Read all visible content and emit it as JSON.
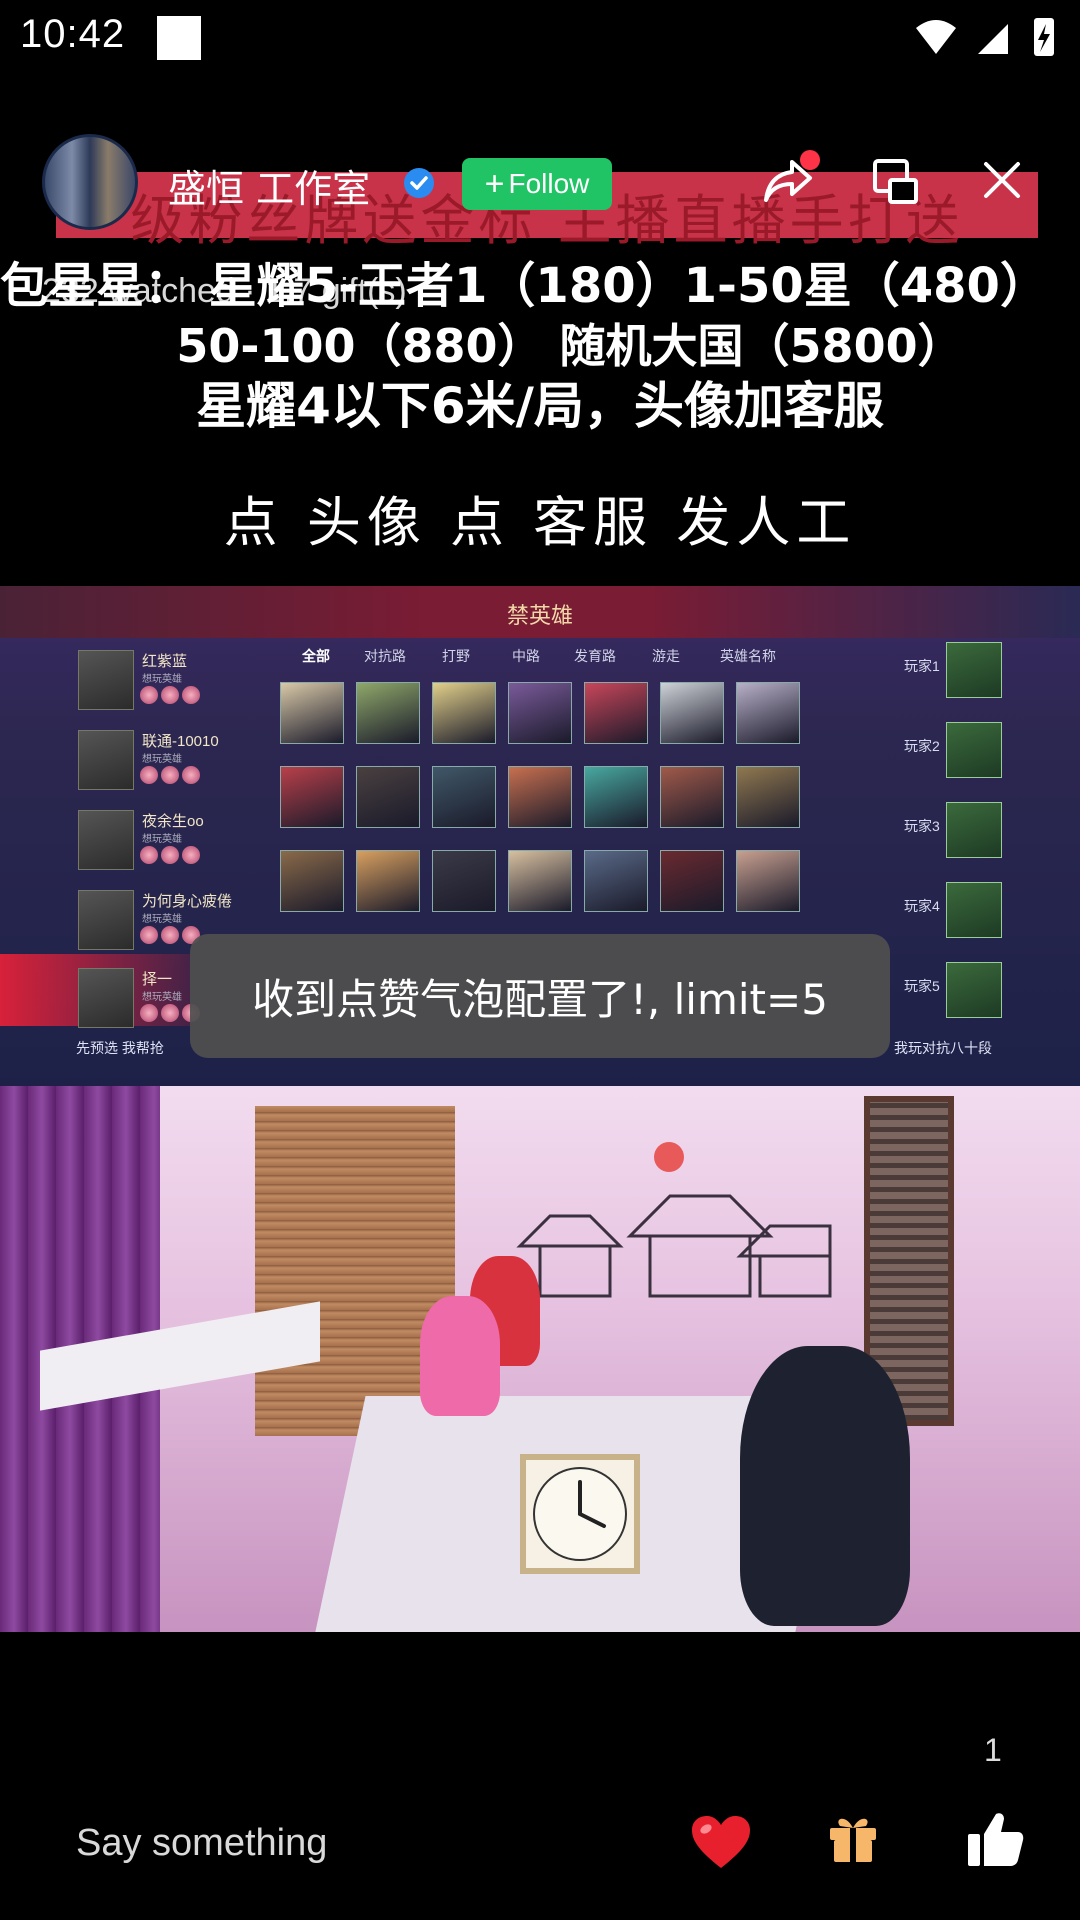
{
  "status_bar": {
    "time": "10:42"
  },
  "banner": {
    "red_text": "级粉丝牌送金标  主播直播手打送",
    "line1": "包星星：  星耀5-王者1（180）1-50星（480）",
    "line2": "50-100（880）  随机大国（5800）",
    "line3": "星耀4以下6米/局，头像加客服",
    "line4": "点  头像  点  客服   发人工"
  },
  "host": {
    "name": "盛恒 工作室",
    "follow_label": "Follow",
    "stats": "232 watched · 1.7 gift(s)"
  },
  "game": {
    "title": "禁英雄",
    "tabs": [
      "全部",
      "对抗路",
      "打野",
      "中路",
      "发育路",
      "游走",
      "英雄名称"
    ],
    "players_left": [
      {
        "name": "红紫蓝",
        "sub": "想玩英雄"
      },
      {
        "name": "联通-10010",
        "sub": "想玩英雄"
      },
      {
        "name": "夜余生oo",
        "sub": "想玩英雄"
      },
      {
        "name": "为何身心疲倦",
        "sub": "想玩英雄"
      },
      {
        "name": "择一",
        "sub": "想玩英雄"
      }
    ],
    "players_right": [
      "玩家1",
      "玩家2",
      "玩家3",
      "玩家4",
      "玩家5"
    ],
    "bottom_left": "先预选    我帮抢",
    "bottom_right": "我玩对抗八十段"
  },
  "toast": {
    "message": "收到点赞气泡配置了!, limit=5"
  },
  "bottom": {
    "like_count": "1",
    "comment_placeholder": "Say something"
  },
  "icons": {
    "verified": "verified-badge-icon",
    "share": "share-icon",
    "pip": "picture-in-picture-icon",
    "close": "close-icon",
    "heart": "heart-icon",
    "gift": "gift-icon",
    "like": "thumbs-up-icon"
  },
  "colors": {
    "follow_bg": "#20c464",
    "banner_red": "#c8334a",
    "notify_dot": "#ff3347",
    "toast_bg": "#505050"
  }
}
